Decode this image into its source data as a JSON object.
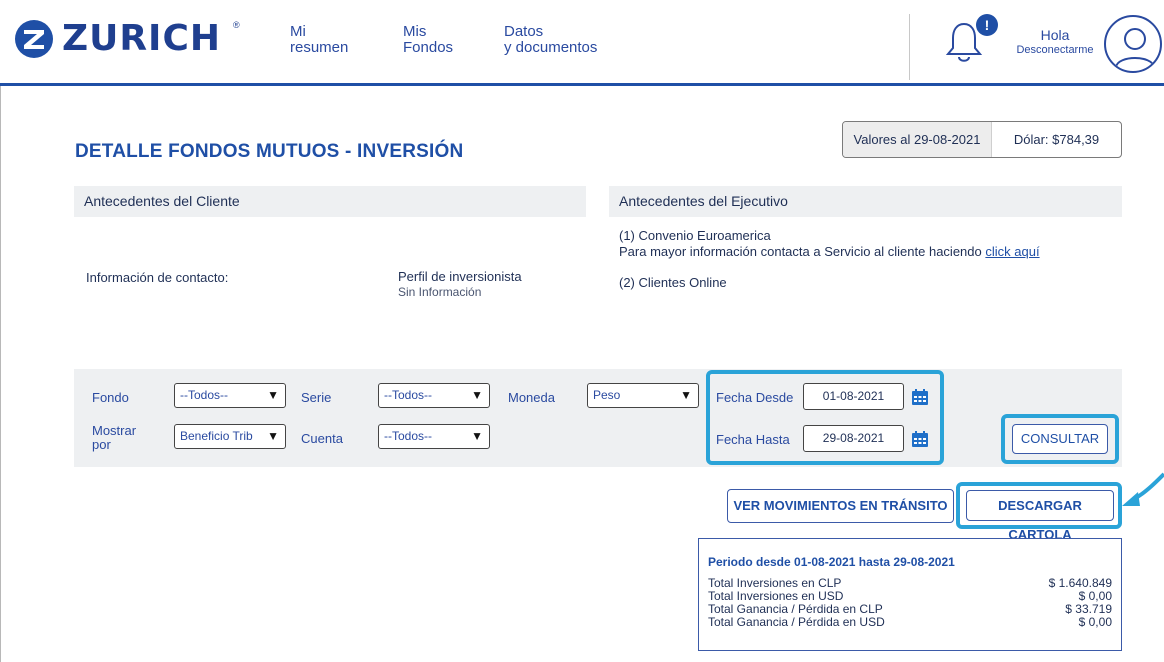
{
  "header": {
    "brand": "ZURICH",
    "brand_mark": "®",
    "nav": [
      {
        "line1": "Mi",
        "line2": "resumen"
      },
      {
        "line1": "Mis",
        "line2": "Fondos"
      },
      {
        "line1": "Datos",
        "line2": "y documentos"
      }
    ],
    "notification_badge": "!",
    "greeting": "Hola",
    "logout": "Desconectarme"
  },
  "page": {
    "title": "DETALLE FONDOS MUTUOS - INVERSIÓN",
    "values_date": "Valores al 29-08-2021",
    "dollar": "Dólar: $784,39"
  },
  "client": {
    "heading": "Antecedentes del Cliente",
    "contact_label": "Información de contacto:",
    "profile_label": "Perfil de inversionista",
    "profile_value": "Sin Información"
  },
  "executive": {
    "heading": "Antecedentes del Ejecutivo",
    "line1": "(1) Convenio Euroamerica",
    "line2": "Para mayor información contacta a Servicio al cliente haciendo",
    "link": "click aquí",
    "line3": "(2) Clientes Online"
  },
  "filters": {
    "fondo_label": "Fondo",
    "fondo_value": "--Todos--",
    "serie_label": "Serie",
    "serie_value": "--Todos--",
    "moneda_label": "Moneda",
    "moneda_value": "Peso",
    "mostrar_label_1": "Mostrar",
    "mostrar_label_2": "por",
    "mostrar_value": "Beneficio Trib",
    "cuenta_label": "Cuenta",
    "cuenta_value": "--Todos--",
    "fecha_desde_label": "Fecha Desde",
    "fecha_desde_value": "01-08-2021",
    "fecha_hasta_label": "Fecha Hasta",
    "fecha_hasta_value": "29-08-2021",
    "consultar": "CONSULTAR"
  },
  "actions": {
    "ver_movimientos": "VER MOVIMIENTOS EN TRÁNSITO",
    "descargar": "DESCARGAR CARTOLA"
  },
  "summary": {
    "title": "Periodo desde 01-08-2021 hasta 29-08-2021",
    "rows": [
      {
        "label": "Total Inversiones en CLP",
        "value": "$ 1.640.849"
      },
      {
        "label": "Total Inversiones en USD",
        "value": "$ 0,00"
      },
      {
        "label": "Total Ganancia / Pérdida en CLP",
        "value": "$ 33.719"
      },
      {
        "label": "Total Ganancia / Pérdida en USD",
        "value": "$ 0,00"
      }
    ]
  },
  "colors": {
    "brand_blue": "#1f4fa6",
    "highlight": "#2aa3d8",
    "panel_gray": "#eef0f2"
  }
}
